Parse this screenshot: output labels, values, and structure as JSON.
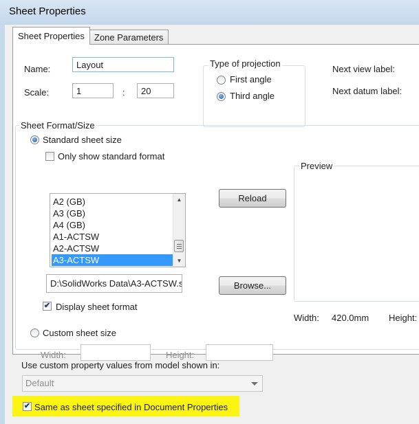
{
  "window": {
    "title": "Sheet Properties"
  },
  "tabs": [
    {
      "label": "Sheet Properties",
      "active": true
    },
    {
      "label": "Zone Parameters",
      "active": false
    }
  ],
  "sheet": {
    "name_label": "Name:",
    "name_value": "Layout",
    "scale_label": "Scale:",
    "scale_num": "1",
    "scale_sep": ":",
    "scale_den": "20"
  },
  "projection": {
    "title": "Type of projection",
    "options": [
      {
        "label": "First angle",
        "selected": false
      },
      {
        "label": "Third angle",
        "selected": true
      }
    ]
  },
  "labels": {
    "next_view": "Next view label:",
    "next_datum": "Next datum label:"
  },
  "format": {
    "title": "Sheet Format/Size",
    "standard_label": "Standard sheet size",
    "standard_selected": true,
    "only_standard_label": "Only show standard format",
    "only_standard_checked": false,
    "list_items": [
      "A2 (GB)",
      "A3 (GB)",
      "A4 (GB)",
      "A1-ACTSW",
      "A2-ACTSW",
      "A3-ACTSW"
    ],
    "selected_item": "A3-ACTSW",
    "reload_label": "Reload",
    "path_value": "D:\\SolidWorks Data\\A3-ACTSW.s",
    "browse_label": "Browse...",
    "display_format_label": "Display sheet format",
    "display_format_checked": true,
    "custom_label": "Custom sheet size",
    "custom_selected": false,
    "width_label": "Width:",
    "height_label": "Height:"
  },
  "preview": {
    "title": "Preview",
    "width_label": "Width:",
    "width_value": "420.0mm",
    "height_label": "Height:"
  },
  "custom_props": {
    "label": "Use custom property values from model shown in:",
    "combo_value": "Default",
    "same_as_label": "Same as sheet specified in Document Properties",
    "same_as_checked": true
  },
  "colors": {
    "highlight": "#fcf413",
    "selection": "#3399ff"
  }
}
